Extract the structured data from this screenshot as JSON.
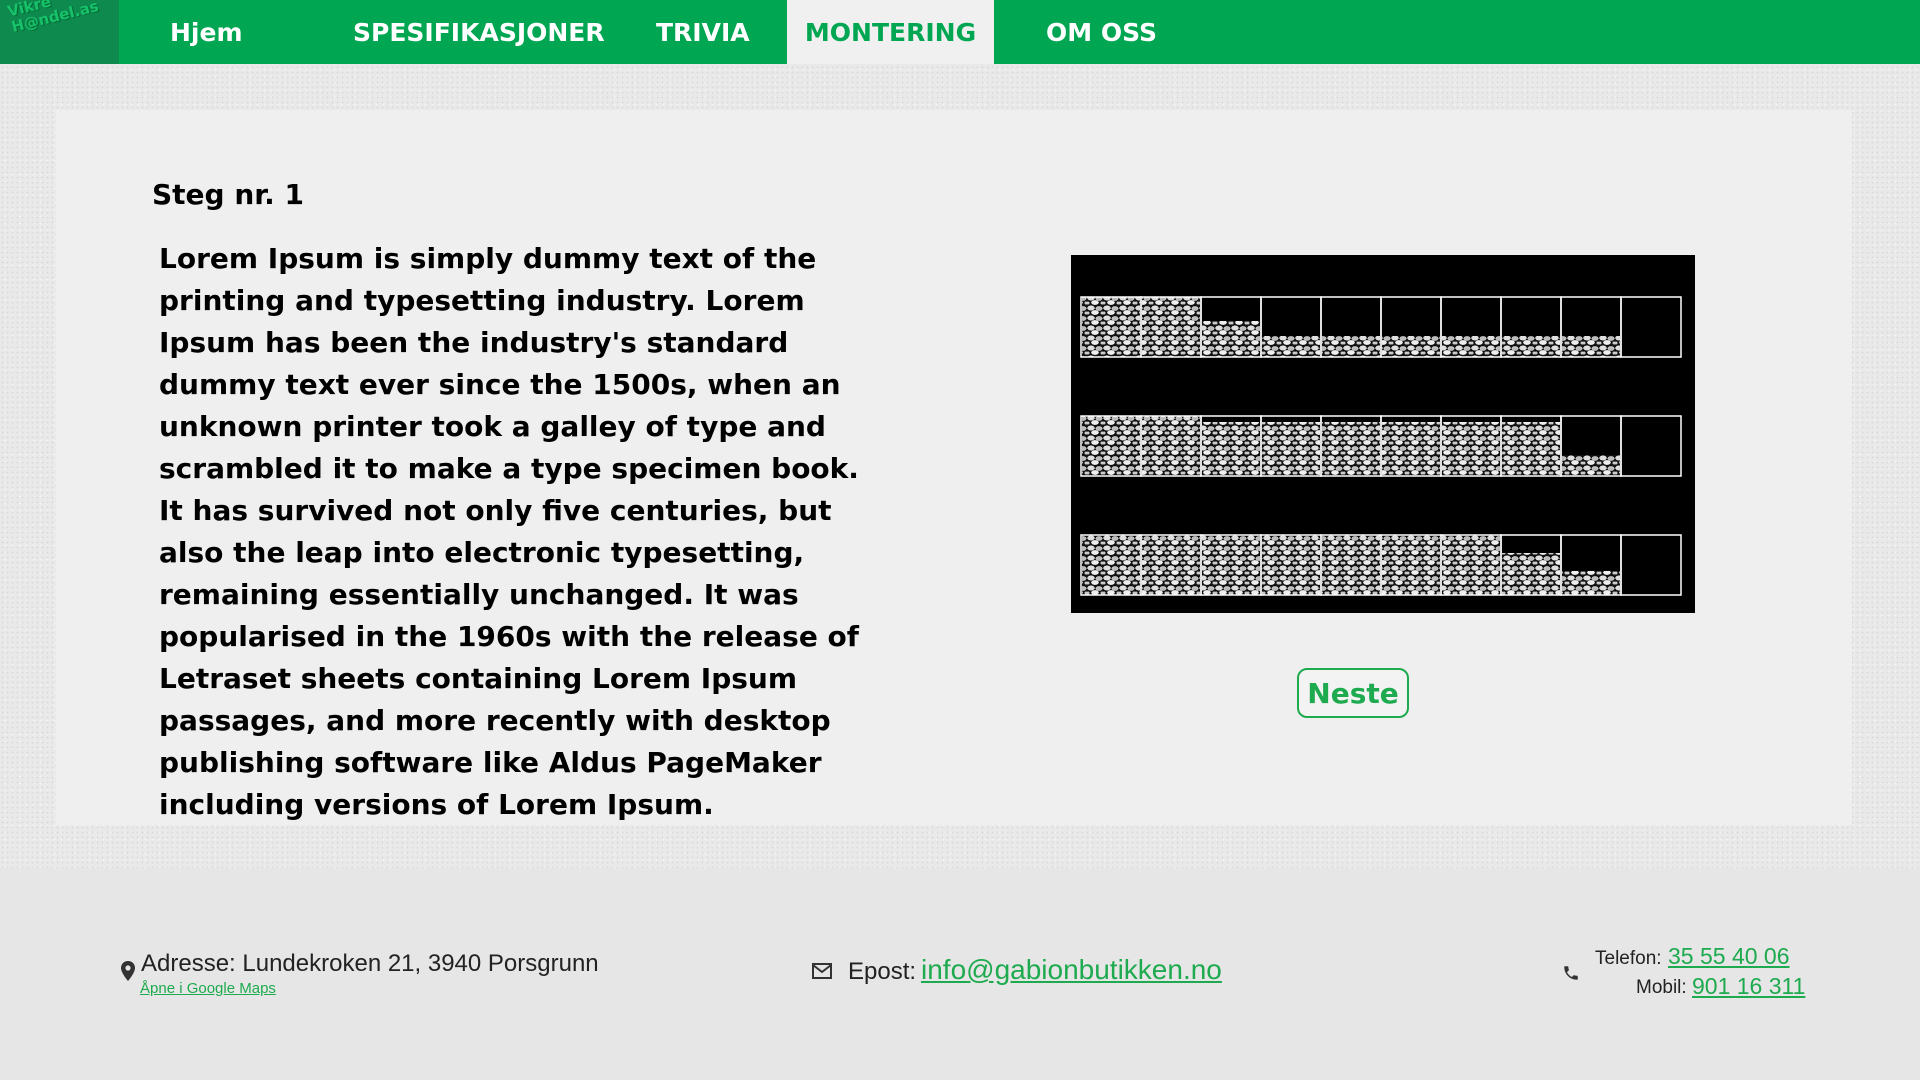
{
  "header": {
    "logo_text": "Vikre\nH@ndel.as",
    "nav": [
      {
        "label": "Hjem"
      },
      {
        "label": "SPESIFIKASJONER"
      },
      {
        "label": "TRIVIA"
      },
      {
        "label": "MONTERING",
        "active": true
      },
      {
        "label": "OM OSS"
      }
    ]
  },
  "main": {
    "step_title": "Steg nr. 1",
    "body": "Lorem Ipsum is simply dummy text of the printing and typesetting industry. Lorem Ipsum has been the industry's standard dummy text ever since the 1500s, when an unknown printer took a galley of type and scrambled it to make a type specimen book. It has survived not only five centuries, but also the leap into electronic typesetting, remaining essentially unchanged. It was popularised in the 1960s with the release of Letraset sheets containing Lorem Ipsum passages, and more recently with desktop publishing software like Aldus PageMaker including versions of Lorem Ipsum.",
    "next_button": "Neste"
  },
  "footer": {
    "address_label": "Adresse:",
    "address": "Lundekroken 21, 3940 Porsgrunn",
    "maps_link": "Åpne i Google Maps",
    "email_label": "Epost:",
    "email": "info@gabionbutikken.no",
    "phone_label": "Telefon:",
    "phone": "35 55 40 06",
    "mobile_label": "Mobil:",
    "mobile": "901 16 311"
  },
  "colors": {
    "brand_green": "#00a651",
    "link_green": "#1eaa4e"
  },
  "icons": [
    "location-pin-icon",
    "mail-icon",
    "phone-icon"
  ]
}
